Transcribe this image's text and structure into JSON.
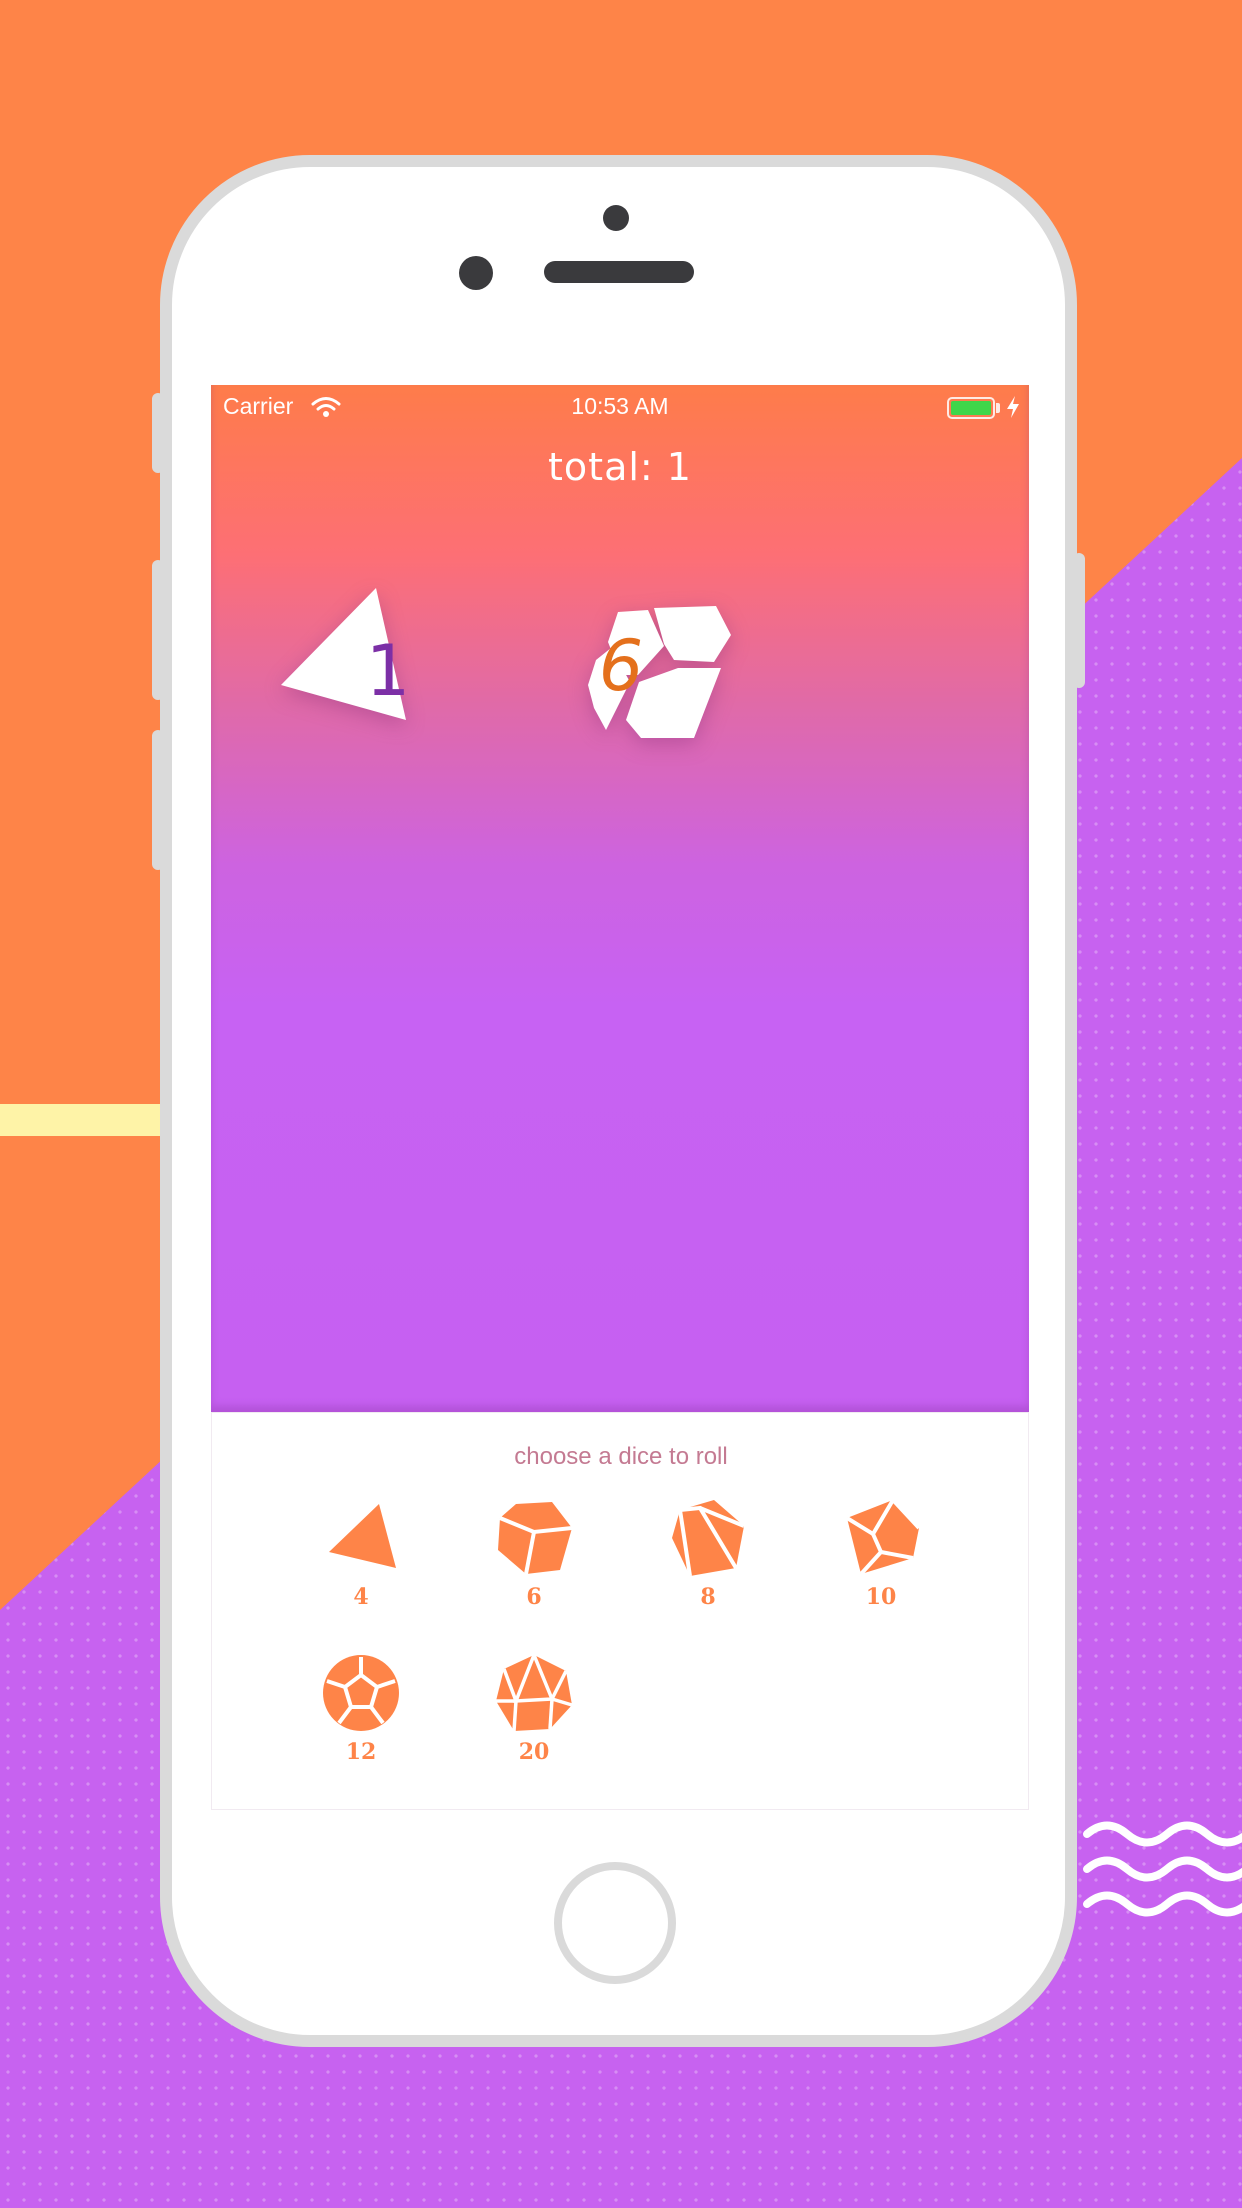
{
  "status_bar": {
    "carrier": "Carrier",
    "time": "10:53 AM",
    "battery_color": "#3fd64a"
  },
  "roll_area": {
    "total": "total: 1",
    "dice": [
      {
        "type": "d4",
        "value": "1",
        "color": "#7c2fa6"
      },
      {
        "type": "d6",
        "value": "6",
        "color": "#e4701c"
      }
    ]
  },
  "chooser": {
    "title": "choose a dice to roll",
    "dice": [
      {
        "label": "4",
        "icon": "d4-icon"
      },
      {
        "label": "6",
        "icon": "d6-icon"
      },
      {
        "label": "8",
        "icon": "d8-icon"
      },
      {
        "label": "10",
        "icon": "d10-icon"
      },
      {
        "label": "12",
        "icon": "d12-icon"
      },
      {
        "label": "20",
        "icon": "d20-icon"
      }
    ]
  },
  "colors": {
    "accent": "#fe8448",
    "purple": "#c762f0",
    "yellow": "#fef3a7"
  }
}
